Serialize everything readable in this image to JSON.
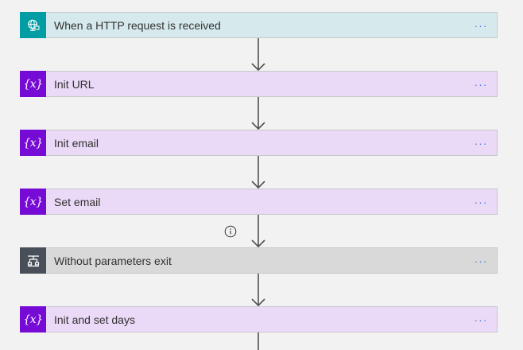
{
  "flow": {
    "steps": [
      {
        "label": "When a HTTP request is received",
        "kind": "http-trigger",
        "icon": "http-request-icon",
        "color": "#009da5"
      },
      {
        "label": "Init URL",
        "kind": "variable",
        "icon": "variable-icon",
        "color": "#770bd6"
      },
      {
        "label": "Init email",
        "kind": "variable",
        "icon": "variable-icon",
        "color": "#770bd6"
      },
      {
        "label": "Set email",
        "kind": "variable",
        "icon": "variable-icon",
        "color": "#770bd6"
      },
      {
        "label": "Without parameters exit",
        "kind": "control",
        "icon": "condition-icon",
        "color": "#484f58"
      },
      {
        "label": "Init and set days",
        "kind": "variable",
        "icon": "variable-icon",
        "color": "#770bd6"
      }
    ],
    "more_label": "···",
    "variable_glyph": "{x}"
  }
}
